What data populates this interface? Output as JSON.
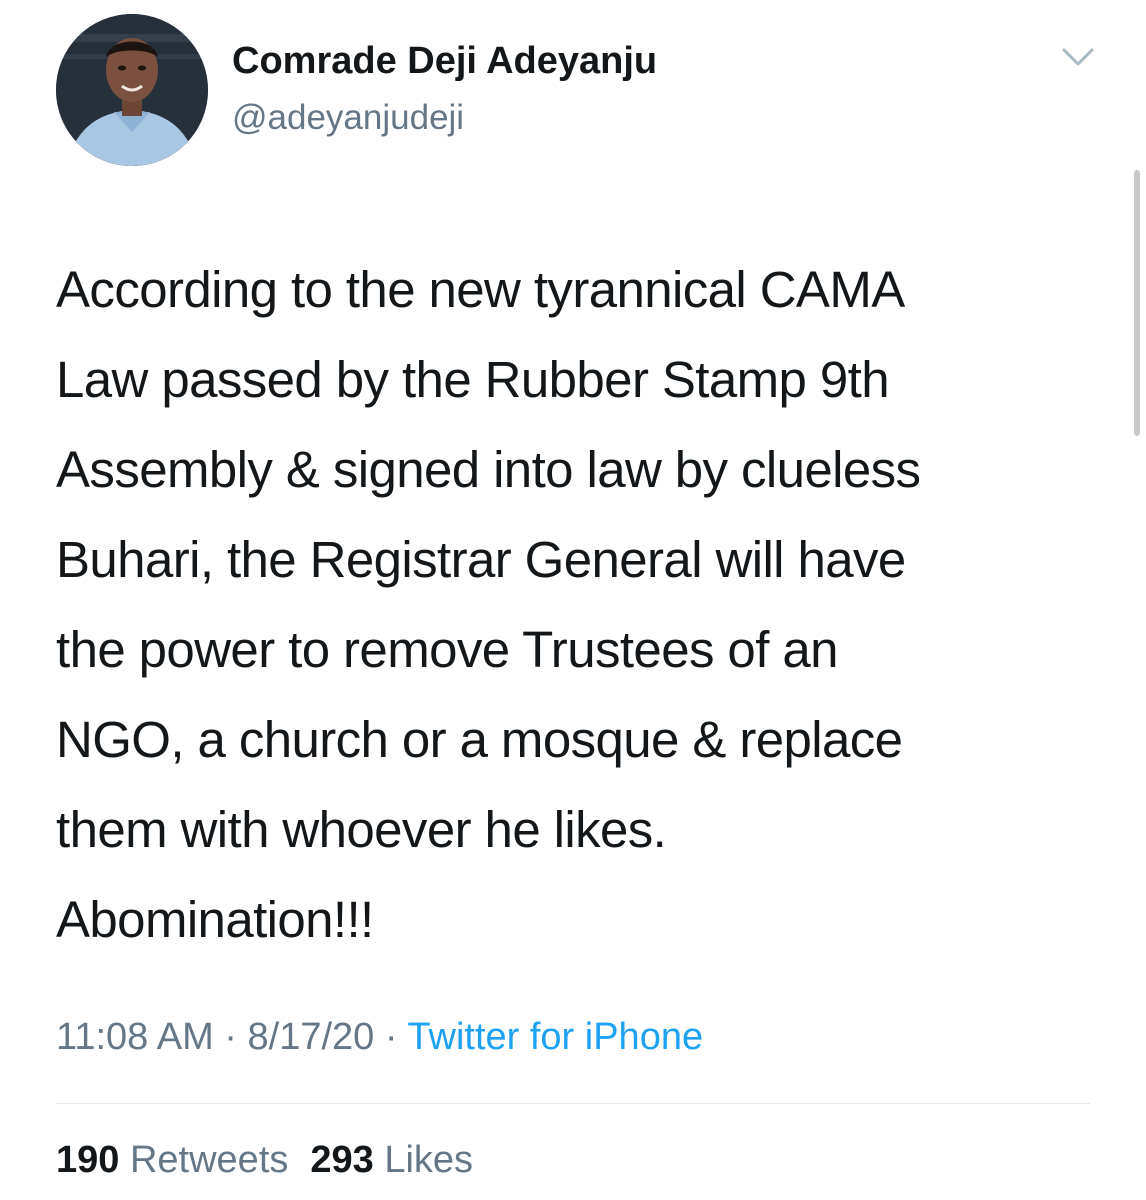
{
  "tweet": {
    "author": {
      "display_name": "Comrade Deji Adeyanju",
      "handle": "@adeyanjudeji",
      "avatar_icon": "profile-photo"
    },
    "menu_icon": "chevron-down-icon",
    "text": "According to the new tyrannical CAMA\nLaw passed by the Rubber Stamp 9th\nAssembly & signed into law by clueless\nBuhari, the Registrar General will have\nthe power to remove Trustees of an\nNGO, a church or a mosque & replace\nthem with whoever he likes.\nAbomination!!!",
    "time": "11:08 AM",
    "separator": "·",
    "date": "8/17/20",
    "source": "Twitter for iPhone",
    "retweets_count": "190",
    "retweets_label": "Retweets",
    "likes_count": "293",
    "likes_label": "Likes"
  },
  "colors": {
    "text_primary": "#14171a",
    "text_secondary": "#657786",
    "link": "#1da1f2",
    "divider": "#e1e8ed"
  }
}
